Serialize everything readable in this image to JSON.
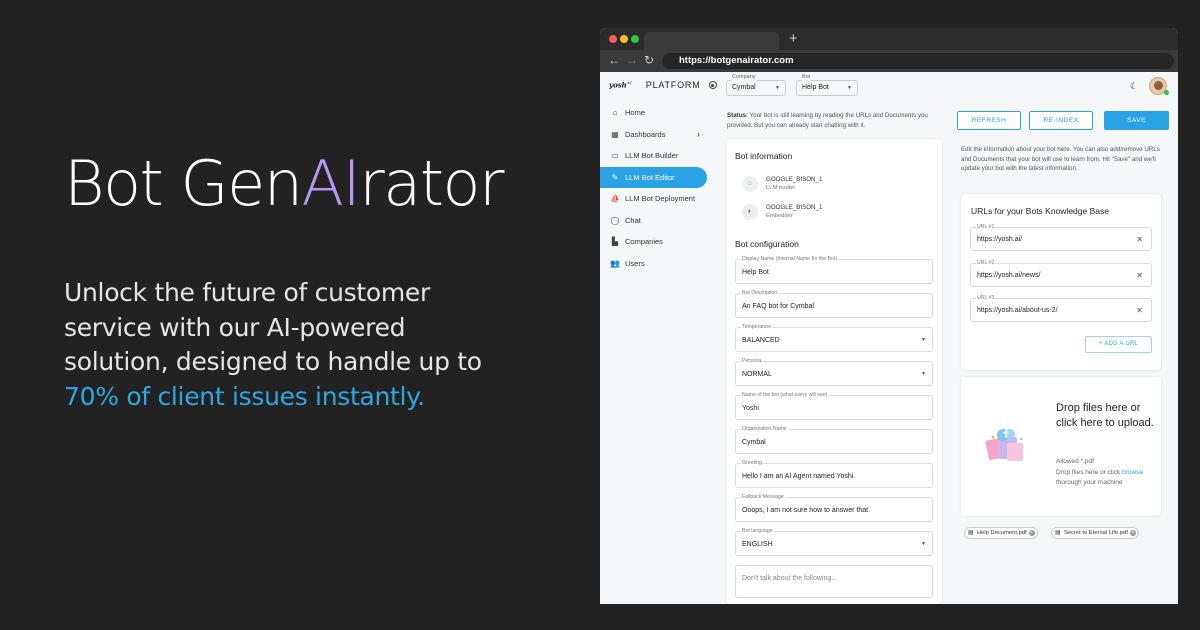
{
  "hero": {
    "title_part1": "Bot Gen",
    "title_ai": "AI",
    "title_part2": "rator",
    "description": "Unlock the future of customer service with our AI-powered solution, designed to handle up to",
    "highlight": "70% of client issues instantly."
  },
  "browser": {
    "url": "https://botgenairator.com",
    "new_tab": "+"
  },
  "sidebar": {
    "logo": "yosh",
    "logo_sup": "AI",
    "platform": "PLATFORM",
    "items": [
      {
        "label": "Home",
        "icon": "⌂"
      },
      {
        "label": "Dashboards",
        "icon": "▦"
      },
      {
        "label": "LLM Bot Builder",
        "icon": "▭"
      },
      {
        "label": "LLM Bot Editor",
        "icon": "✎"
      },
      {
        "label": "LLM Bot Deployment",
        "icon": "⛵"
      },
      {
        "label": "Chat",
        "icon": "◯"
      },
      {
        "label": "Companies",
        "icon": "▙"
      },
      {
        "label": "Users",
        "icon": "👥"
      }
    ]
  },
  "topbar": {
    "company_label": "Company",
    "company_value": "Cymbal",
    "bot_label": "Bot",
    "bot_value": "Help Bot"
  },
  "status": {
    "label": "Status:",
    "text": "Your bot is still learning by reading the URLs and Documents you provided. But you can already start chatting with it."
  },
  "actions": {
    "refresh": "REFRESH",
    "reindex": "RE-INDEX",
    "save": "SAVE"
  },
  "bot_info": {
    "title": "Bot information",
    "llm_name": "GOOGLE_BISON_1",
    "llm_sub": "LLM model",
    "emb_name": "GOOGLE_BISON_1",
    "emb_sub": "Embedder"
  },
  "bot_config": {
    "title": "Bot configuration",
    "fields": [
      {
        "label": "Display Name (Internal Name for the Bot)",
        "value": "Help Bot"
      },
      {
        "label": "Bot Description",
        "value": "An FAQ bot for Cymbal"
      },
      {
        "label": "Temperature",
        "value": "BALANCED"
      },
      {
        "label": "Persona",
        "value": "NORMAL"
      },
      {
        "label": "Name of the bot (what users will see)",
        "value": "Yoshi"
      },
      {
        "label": "Organization Name",
        "value": "Cymbal"
      },
      {
        "label": "Greeting",
        "value": "Hello I am an AI Agent named Yoshi."
      },
      {
        "label": "Fallback Message",
        "value": "Ooops, I am not sure how to answer that."
      },
      {
        "label": "Bot language",
        "value": "ENGLISH"
      }
    ],
    "restrict_placeholder": "Don't talk about the following..."
  },
  "right_info": "Edit the information about your bot here. You can also add/remove URLs and Documents that your bot will use to learn from. Hit \"Save\" and we'll update your bot with the latest information.",
  "urls": {
    "title": "URLs for your Bots Knowledge Base",
    "items": [
      {
        "label": "URL #1",
        "value": "https://yosh.ai/"
      },
      {
        "label": "URL #2",
        "value": "https://yosh.ai/news/"
      },
      {
        "label": "URL #3",
        "value": "https://yosh.ai/about-us-2/"
      }
    ],
    "add_label": "ADD A URL"
  },
  "dropzone": {
    "title": "Drop files here or click here to upload.",
    "allowed": "Allowed *.pdf",
    "hint_before": "Drop files here or click",
    "browse": "browse",
    "hint_after": "thorough your machine"
  },
  "files": [
    "Help Document.pdf",
    "Secret to Eternal Life.pdf"
  ]
}
